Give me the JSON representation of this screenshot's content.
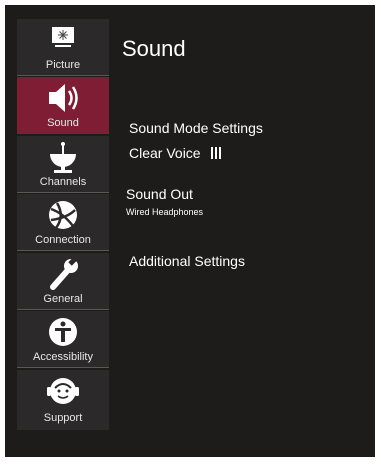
{
  "page": {
    "title": "Sound"
  },
  "sidebar": {
    "items": [
      {
        "label": "Picture",
        "icon": "picture-icon",
        "active": false
      },
      {
        "label": "Sound",
        "icon": "speaker-icon",
        "active": true
      },
      {
        "label": "Channels",
        "icon": "satellite-dish-icon",
        "active": false
      },
      {
        "label": "Connection",
        "icon": "network-globe-icon",
        "active": false
      },
      {
        "label": "General",
        "icon": "wrench-icon",
        "active": false
      },
      {
        "label": "Accessibility",
        "icon": "accessibility-person-icon",
        "active": false
      },
      {
        "label": "Support",
        "icon": "support-headset-icon",
        "active": false
      }
    ]
  },
  "settings": {
    "sound_mode": "Sound Mode Settings",
    "clear_voice": "Clear Voice",
    "clear_voice_level_icon": "level-bars-icon",
    "sound_out": "Sound Out",
    "sound_out_value": "Wired Headphones",
    "additional": "Additional Settings"
  },
  "colors": {
    "background": "#1e1b1b",
    "sidebar": "#2b2929",
    "accent": "#7e1d33",
    "text": "#ffffff"
  }
}
